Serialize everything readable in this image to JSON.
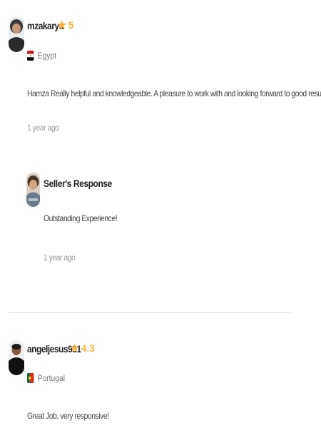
{
  "reviews": [
    {
      "username": "mzakarya",
      "rating": "5",
      "country": "Egypt",
      "country_flag": "egypt-flag",
      "text": "Hamza Really helpful and knowledgeable. A pleasure to work with and looking forward to good results!",
      "time": "1 year ago",
      "seller_response": {
        "title": "Seller's Response",
        "text": "Outstanding Experience!",
        "time": "1 year ago"
      }
    },
    {
      "username": "angeljesus931",
      "rating": "4.3",
      "country": "Portugal",
      "country_flag": "portugal-flag",
      "text": "Great Job, very responsive!"
    }
  ],
  "colors": {
    "star": "#ffb33e",
    "muted_text": "#95979d",
    "divider": "#dadbdd"
  }
}
